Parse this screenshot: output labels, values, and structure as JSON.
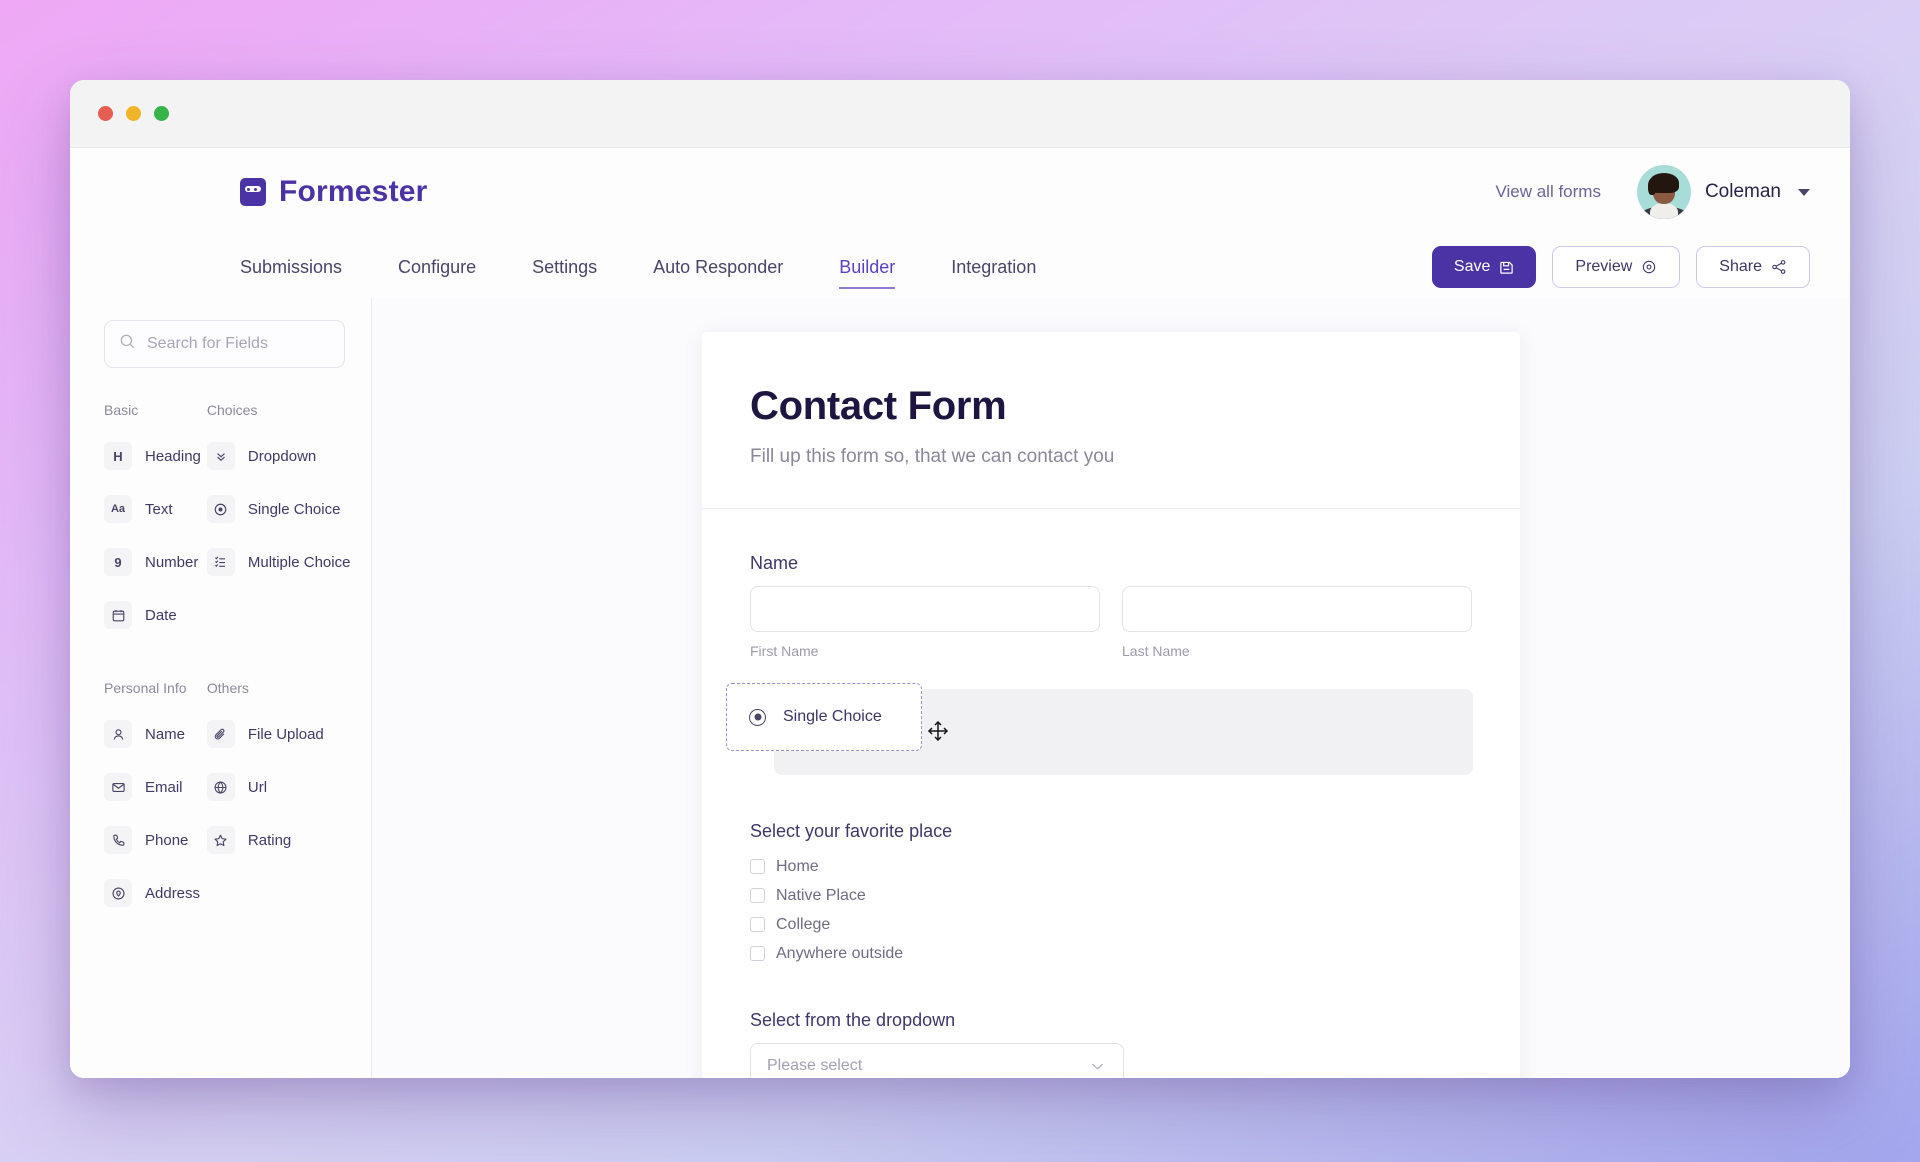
{
  "window": {
    "traffic_lights": [
      "close",
      "minimize",
      "maximize"
    ]
  },
  "header": {
    "brand_name": "Formester",
    "brand_icon": "formester-logo-icon",
    "view_all_forms": "View all forms",
    "user_name": "Coleman",
    "user_caret_icon": "chevron-down-icon",
    "avatar_icon": "user-avatar"
  },
  "nav": {
    "tabs": [
      {
        "label": "Submissions",
        "active": false
      },
      {
        "label": "Configure",
        "active": false
      },
      {
        "label": "Settings",
        "active": false
      },
      {
        "label": "Auto Responder",
        "active": false
      },
      {
        "label": "Builder",
        "active": true
      },
      {
        "label": "Integration",
        "active": false
      }
    ],
    "actions": {
      "save_label": "Save",
      "save_icon": "save-disk-icon",
      "preview_label": "Preview",
      "preview_icon": "eye-icon",
      "share_label": "Share",
      "share_icon": "share-nodes-icon"
    }
  },
  "sidebar": {
    "search": {
      "placeholder": "Search for Fields",
      "value": "",
      "icon": "search-icon"
    },
    "groups": [
      {
        "title": "Basic",
        "items": [
          {
            "label": "Heading",
            "icon": "heading-icon",
            "glyph": "H"
          },
          {
            "label": "Text",
            "icon": "text-aa-icon",
            "glyph": "Aa"
          },
          {
            "label": "Number",
            "icon": "number-icon",
            "glyph": "9"
          },
          {
            "label": "Date",
            "icon": "calendar-icon",
            "glyph": ""
          }
        ]
      },
      {
        "title": "Choices",
        "items": [
          {
            "label": "Dropdown",
            "icon": "double-chevron-down-icon",
            "glyph": ""
          },
          {
            "label": "Single Choice",
            "icon": "radio-button-icon",
            "glyph": ""
          },
          {
            "label": "Multiple Choice",
            "icon": "list-checks-icon",
            "glyph": ""
          }
        ]
      },
      {
        "title": "Personal Info",
        "items": [
          {
            "label": "Name",
            "icon": "person-icon",
            "glyph": ""
          },
          {
            "label": "Email",
            "icon": "envelope-icon",
            "glyph": ""
          },
          {
            "label": "Phone",
            "icon": "phone-icon",
            "glyph": ""
          },
          {
            "label": "Address",
            "icon": "map-pin-icon",
            "glyph": ""
          }
        ]
      },
      {
        "title": "Others",
        "items": [
          {
            "label": "File Upload",
            "icon": "paperclip-icon",
            "glyph": ""
          },
          {
            "label": "Url",
            "icon": "globe-icon",
            "glyph": ""
          },
          {
            "label": "Rating",
            "icon": "star-icon",
            "glyph": ""
          }
        ]
      }
    ]
  },
  "form": {
    "title": "Contact Form",
    "subtitle": "Fill up this form so, that we can contact you",
    "name_field": {
      "label": "Name",
      "first": {
        "value": "",
        "caption": "First Name"
      },
      "last": {
        "value": "",
        "caption": "Last Name"
      }
    },
    "drag": {
      "chip_label": "Single Choice",
      "chip_icon": "radio-button-icon",
      "cursor_icon": "move-cursor-icon"
    },
    "checkbox_group": {
      "title": "Select your favorite place",
      "options": [
        {
          "label": "Home",
          "checked": false
        },
        {
          "label": "Native Place",
          "checked": false
        },
        {
          "label": "College",
          "checked": false
        },
        {
          "label": "Anywhere outside",
          "checked": false
        }
      ]
    },
    "dropdown_group": {
      "title": "Select from the dropdown",
      "placeholder": "Please select",
      "caret_icon": "chevron-down-icon"
    }
  },
  "colors": {
    "brand_purple": "#4c33a5",
    "accent_purple": "#5b3fc4",
    "title_navy": "#1e1640",
    "muted": "#8a8798"
  }
}
